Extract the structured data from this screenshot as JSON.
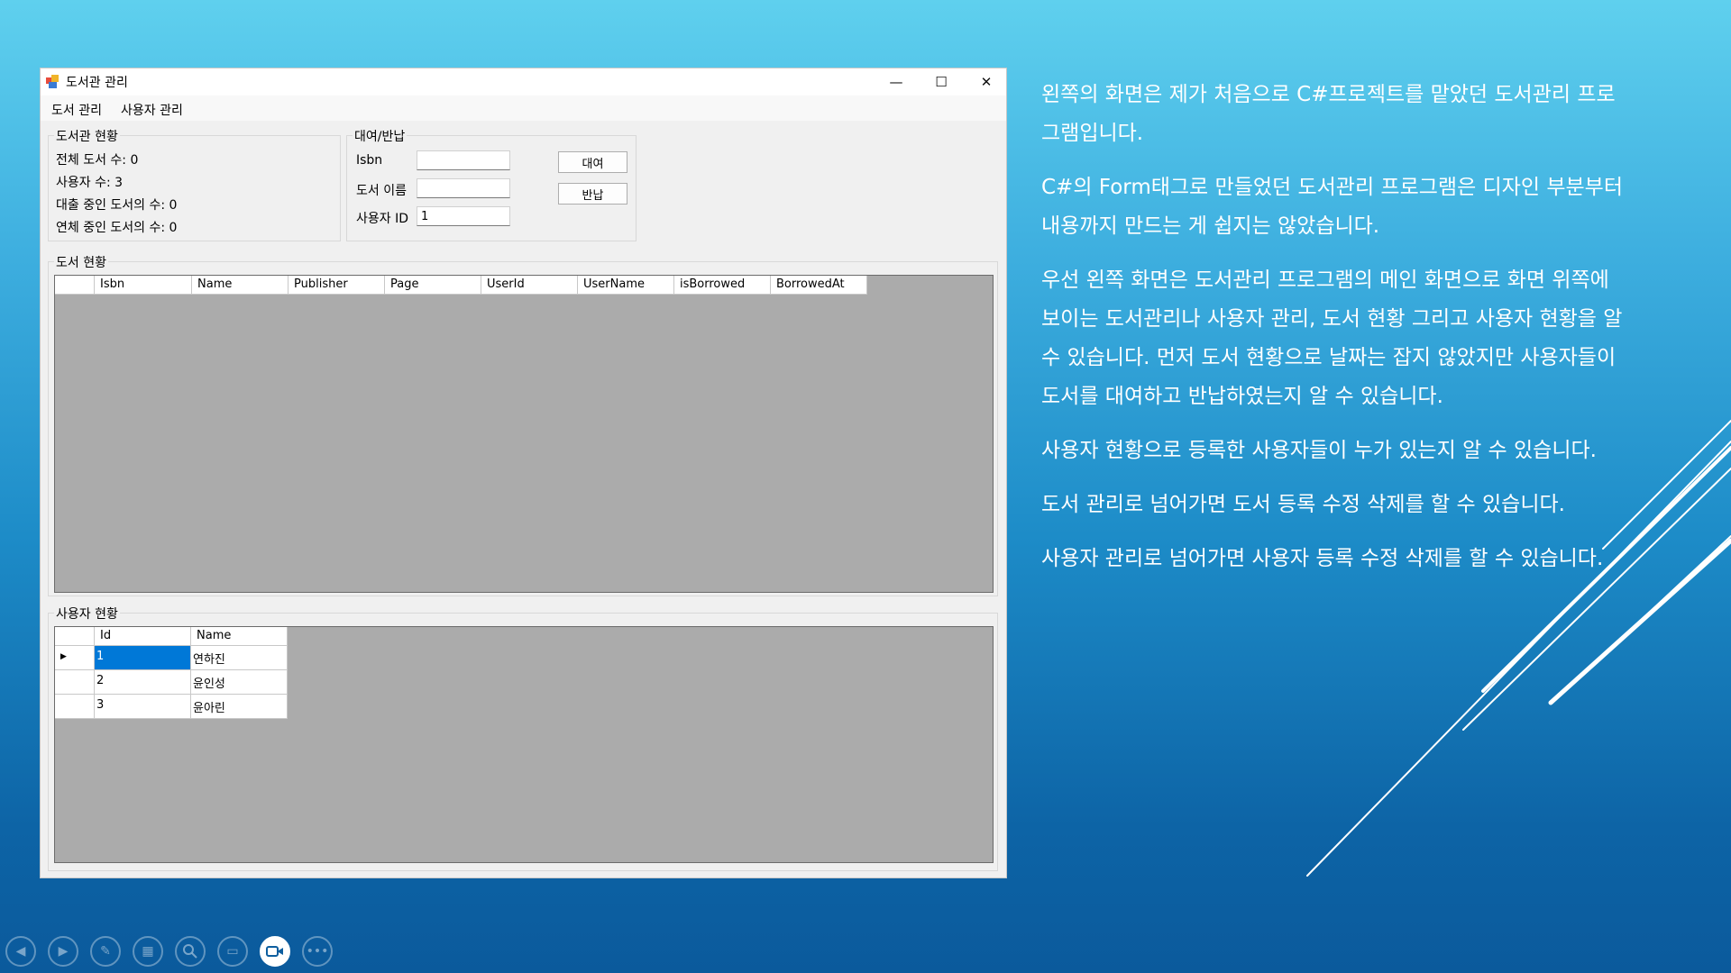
{
  "window": {
    "title": "도서관 관리",
    "menu": [
      "도서 관리",
      "사용자 관리"
    ],
    "controls": {
      "minimize": "—",
      "maximize": "☐",
      "close": "✕"
    }
  },
  "library_status": {
    "title": "도서관 현황",
    "total_books": "전체 도서 수: 0",
    "users": "사용자 수: 3",
    "borrowed": "대출 중인 도서의 수: 0",
    "overdue": "연체 중인 도서의 수: 0"
  },
  "lend_return": {
    "title": "대여/반납",
    "isbn_label": "Isbn",
    "isbn_value": "",
    "book_name_label": "도서 이름",
    "book_name_value": "",
    "user_id_label": "사용자 ID",
    "user_id_value": "1",
    "lend_button": "대여",
    "return_button": "반납"
  },
  "book_status": {
    "title": "도서 현황",
    "columns": [
      "Isbn",
      "Name",
      "Publisher",
      "Page",
      "UserId",
      "UserName",
      "isBorrowed",
      "BorrowedAt"
    ]
  },
  "user_status": {
    "title": "사용자 현황",
    "columns": [
      "Id",
      "Name"
    ],
    "rows": [
      {
        "id": "1",
        "name": "연하진"
      },
      {
        "id": "2",
        "name": "윤인성"
      },
      {
        "id": "3",
        "name": "윤아린"
      }
    ]
  },
  "description": [
    "왼쪽의 화면은 제가 처음으로 C#프로젝트를 맡았던 도서관리 프로그램입니다.",
    "C#의 Form태그로 만들었던 도서관리 프로그램은 디자인 부분부터 내용까지 만드는 게 쉽지는 않았습니다.",
    "우선 왼쪽 화면은 도서관리 프로그램의 메인 화면으로 화면 위쪽에 보이는 도서관리나 사용자 관리, 도서 현황 그리고 사용자 현황을 알 수 있습니다. 먼저 도서 현황으로 날짜는 잡지 않았지만 사용자들이 도서를 대여하고 반납하였는지 알 수 있습니다.",
    "사용자 현황으로 등록한 사용자들이 누가 있는지 알 수 있습니다.",
    "도서 관리로 넘어가면 도서 등록 수정 삭제를 할 수 있습니다.",
    "사용자 관리로 넘어가면 사용자 등록 수정 삭제를 할 수 있습니다."
  ],
  "slideshow_toolbar": [
    "previous-icon",
    "next-icon",
    "pen-icon",
    "slides-icon",
    "zoom-icon",
    "subtitles-icon",
    "camera-icon",
    "more-icon"
  ],
  "colors": {
    "selection": "#0078d7",
    "grid_background": "#ababab"
  }
}
